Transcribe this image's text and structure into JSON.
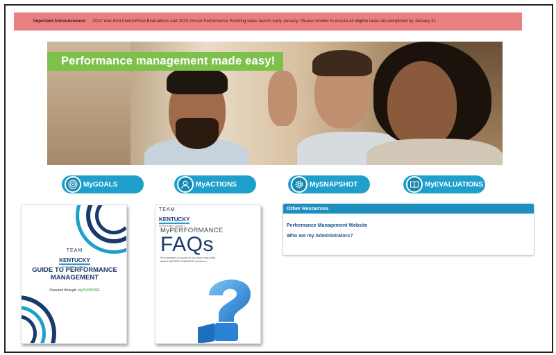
{
  "announcement": {
    "label": "Important Announcement",
    "text": "2023 Year-End Interim/Final Evaluations and 2024 Annual Performance Planning tasks launch early January. Please monitor to ensure all eligible tasks are completed by January 31."
  },
  "hero": {
    "banner_text": "Performance management made easy!"
  },
  "nav_buttons": [
    {
      "label": "MyGOALS",
      "icon": "target-icon"
    },
    {
      "label": "MyACTIONS",
      "icon": "person-icon"
    },
    {
      "label": "MySNAPSHOT",
      "icon": "gear-icon"
    },
    {
      "label": "MyEVALUATIONS",
      "icon": "book-icon"
    }
  ],
  "guide_book": {
    "team": "TEAM",
    "kentucky": "KENTUCKY",
    "subtitle": "PERSONNEL CABINET",
    "title_line1": "GUIDE TO PERFORMANCE",
    "title_line2": "MANAGEMENT",
    "powered_prefix": "Powered through:",
    "powered_brand": "MyPURPOSE"
  },
  "faq_book": {
    "team": "TEAM",
    "kentucky": "KENTUCKY",
    "subtitle": "PERSONNEL CABINET",
    "top": "MyPERFORMANCE",
    "big": "FAQs",
    "desc": "Find answers to some of our most frequently asked MyPERFORMANCE questions."
  },
  "resources": {
    "header": "Other Resources",
    "links": [
      "Performance Management Website",
      "Who are my Administrators?"
    ]
  },
  "colors": {
    "announcement_bg": "#ea7f82",
    "banner_green": "#7dc04a",
    "button_blue": "#1fa0cc",
    "navy": "#1a3a6b"
  }
}
